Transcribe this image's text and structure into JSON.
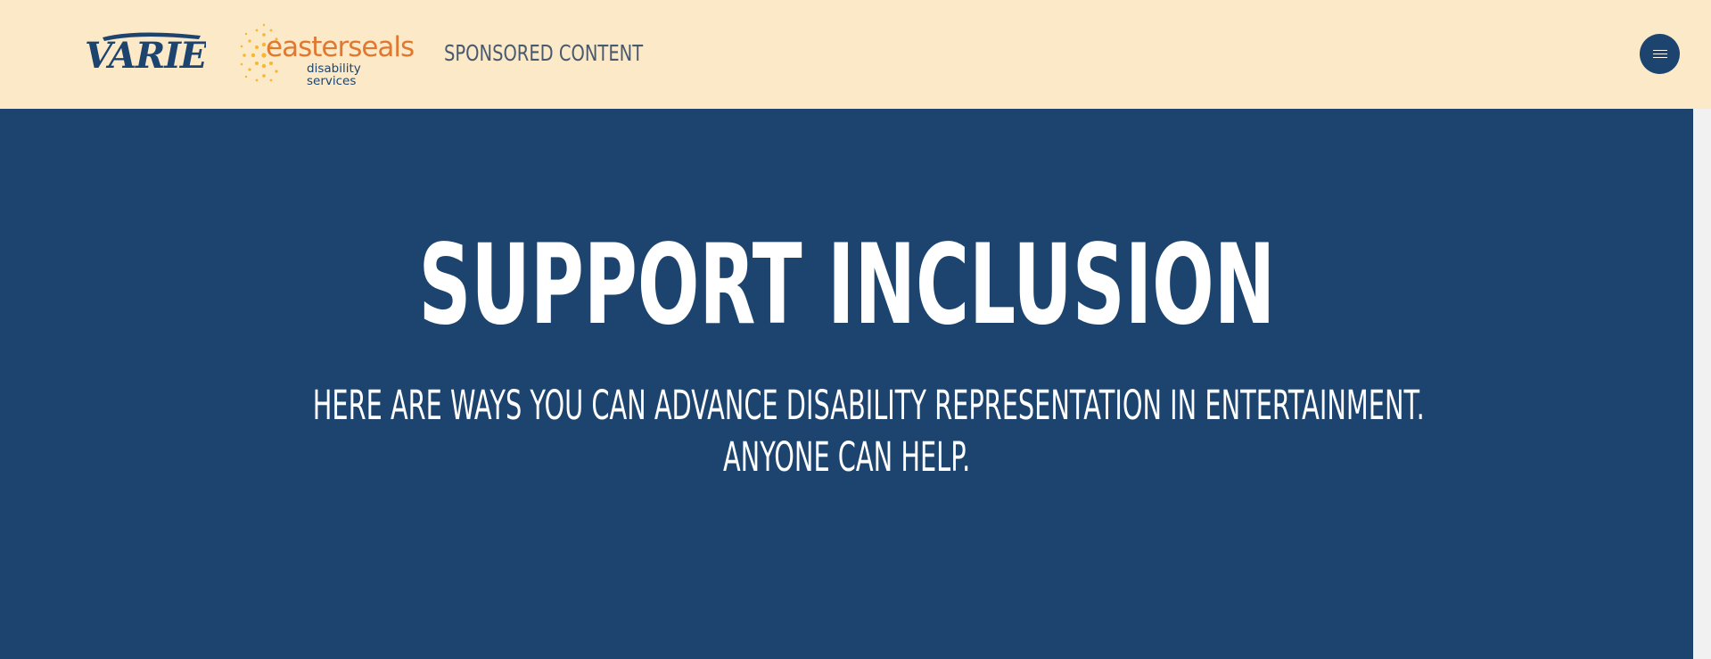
{
  "colors": {
    "header_bg": "#fbe9c8",
    "navy": "#1c446f",
    "easterseals_orange": "#e07830",
    "easterseals_sun": "#f5b82e",
    "sponsored_text": "#4a5a6e",
    "white": "#ffffff"
  },
  "header": {
    "logos": {
      "variety": "VARIETY",
      "easterseals_word": "easterseals",
      "easterseals_sub": "disability services"
    },
    "sponsored_label": "SPONSORED CONTENT",
    "menu_icon": "hamburger-menu-icon"
  },
  "hero": {
    "title": "SUPPORT INCLUSION",
    "subtitle_line1": "HERE ARE WAYS YOU CAN ADVANCE DISABILITY REPRESENTATION IN ENTERTAINMENT.",
    "subtitle_line2": "ANYONE CAN HELP."
  }
}
